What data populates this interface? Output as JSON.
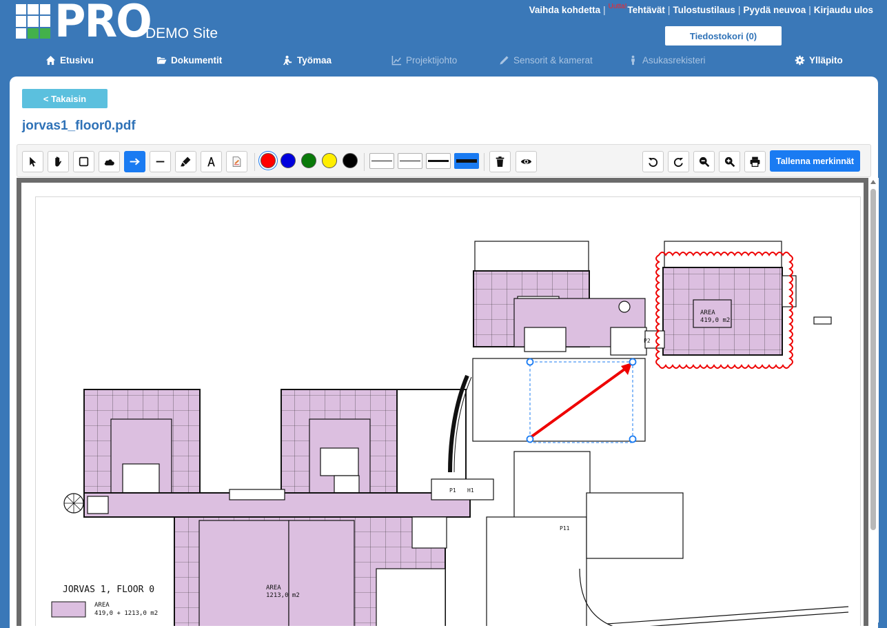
{
  "header": {
    "logo_text": "PRO",
    "site_name": "DEMO Site",
    "links": [
      {
        "label": "Vaihda kohdetta"
      },
      {
        "label": "Tehtävät",
        "badge": "Uutta!"
      },
      {
        "label": "Tulostustilaus"
      },
      {
        "label": "Pyydä neuvoa"
      },
      {
        "label": "Kirjaudu ulos"
      }
    ],
    "cart_label": "Tiedostokori (0)"
  },
  "nav": {
    "items": [
      {
        "label": "Etusivu",
        "icon": "home-icon"
      },
      {
        "label": "Dokumentit",
        "icon": "folder-open-icon"
      },
      {
        "label": "Työmaa",
        "icon": "worker-icon"
      },
      {
        "label": "Projektijohto",
        "icon": "chart-icon"
      },
      {
        "label": "Sensorit & kamerat",
        "icon": "pencil-icon"
      },
      {
        "label": "Asukasrekisteri",
        "icon": "person-icon"
      },
      {
        "label": "Ylläpito",
        "icon": "gear-icon"
      }
    ]
  },
  "main": {
    "back_label": "< Takaisin",
    "doc_title": "jorvas1_floor0.pdf"
  },
  "toolbar": {
    "tools": [
      "pointer-icon",
      "hand-icon",
      "square-icon",
      "cloud-icon",
      "arrow-right-icon",
      "line-icon",
      "highlighter-icon",
      "text-icon",
      "stamp-icon"
    ],
    "active_tool": "arrow-right-icon",
    "colors": [
      "#ff0000",
      "#0000dd",
      "#0a7a0a",
      "#ffee00",
      "#000000"
    ],
    "selected_color": "#ff0000",
    "save_label": "Tallenna merkinnät"
  },
  "drawing": {
    "legend_title": "JORVAS 1, FLOOR 0",
    "legend_label": "AREA",
    "legend_value": "419,0 + 1213,0 m2",
    "area_upper_label": "AREA",
    "area_upper_value": "419,0 m2",
    "area_lower_label": "AREA",
    "area_lower_value": "1213,0 m2",
    "room_tags": [
      "P1",
      "H1",
      "P2",
      "P11"
    ],
    "room_fill": "#dcbfe0",
    "markup_color": "#ee0000",
    "selection_color": "#1a7bf2"
  }
}
